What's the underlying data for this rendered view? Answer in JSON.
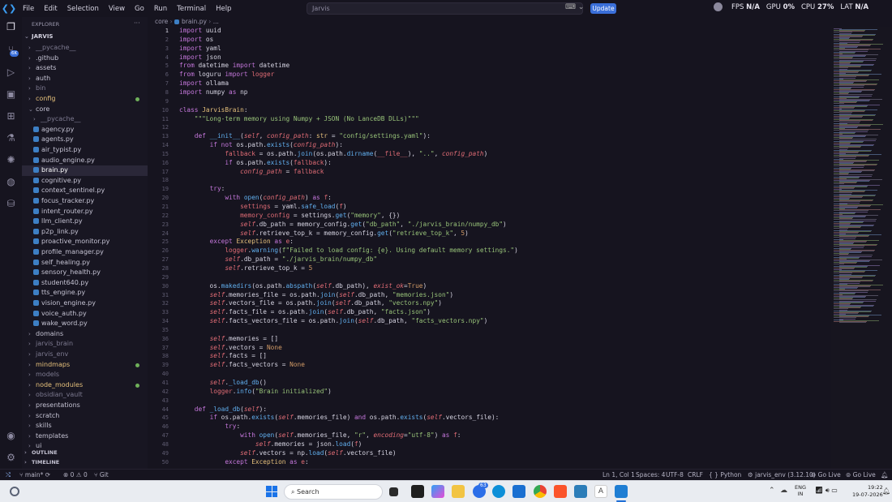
{
  "titlebar": {
    "menus": [
      "File",
      "Edit",
      "Selection",
      "View",
      "Go",
      "Run",
      "Terminal",
      "Help"
    ],
    "search_placeholder": "Jarvis",
    "update_label": "Update"
  },
  "perf": {
    "fps_label": "FPS",
    "fps_value": "N/A",
    "gpu_label": "GPU",
    "gpu_value": "0%",
    "cpu_label": "CPU",
    "cpu_value": "27%",
    "lat_label": "LAT",
    "lat_value": "N/A"
  },
  "sidebar": {
    "title": "EXPLORER",
    "root": "JARVIS",
    "items": [
      {
        "label": "__pycache__",
        "depth": 1,
        "folder": true,
        "dim": true
      },
      {
        "label": ".github",
        "depth": 1,
        "folder": true
      },
      {
        "label": "assets",
        "depth": 1,
        "folder": true
      },
      {
        "label": "auth",
        "depth": 1,
        "folder": true
      },
      {
        "label": "bin",
        "depth": 1,
        "folder": true,
        "dim": true
      },
      {
        "label": "config",
        "depth": 1,
        "folder": true,
        "mod": true,
        "color": "#e5c07b"
      },
      {
        "label": "core",
        "depth": 1,
        "folder": true,
        "open": true
      },
      {
        "label": "__pycache__",
        "depth": 2,
        "folder": true,
        "dim": true
      },
      {
        "label": "agency.py",
        "depth": 2
      },
      {
        "label": "agents.py",
        "depth": 2
      },
      {
        "label": "air_typist.py",
        "depth": 2
      },
      {
        "label": "audio_engine.py",
        "depth": 2
      },
      {
        "label": "brain.py",
        "depth": 2,
        "selected": true
      },
      {
        "label": "cognitive.py",
        "depth": 2
      },
      {
        "label": "context_sentinel.py",
        "depth": 2
      },
      {
        "label": "focus_tracker.py",
        "depth": 2
      },
      {
        "label": "intent_router.py",
        "depth": 2
      },
      {
        "label": "llm_client.py",
        "depth": 2
      },
      {
        "label": "p2p_link.py",
        "depth": 2
      },
      {
        "label": "proactive_monitor.py",
        "depth": 2
      },
      {
        "label": "profile_manager.py",
        "depth": 2
      },
      {
        "label": "self_healing.py",
        "depth": 2
      },
      {
        "label": "sensory_health.py",
        "depth": 2
      },
      {
        "label": "student640.py",
        "depth": 2
      },
      {
        "label": "tts_engine.py",
        "depth": 2
      },
      {
        "label": "vision_engine.py",
        "depth": 2
      },
      {
        "label": "voice_auth.py",
        "depth": 2
      },
      {
        "label": "wake_word.py",
        "depth": 2
      },
      {
        "label": "domains",
        "depth": 1,
        "folder": true
      },
      {
        "label": "jarvis_brain",
        "depth": 1,
        "folder": true,
        "dim": true
      },
      {
        "label": "jarvis_env",
        "depth": 1,
        "folder": true,
        "dim": true
      },
      {
        "label": "mindmaps",
        "depth": 1,
        "folder": true,
        "mod": true,
        "color": "#e5c07b"
      },
      {
        "label": "models",
        "depth": 1,
        "folder": true,
        "dim": true
      },
      {
        "label": "node_modules",
        "depth": 1,
        "folder": true,
        "mod": true,
        "color": "#e5c07b"
      },
      {
        "label": "obsidian_vault",
        "depth": 1,
        "folder": true,
        "dim": true
      },
      {
        "label": "presentations",
        "depth": 1,
        "folder": true
      },
      {
        "label": "scratch",
        "depth": 1,
        "folder": true
      },
      {
        "label": "skills",
        "depth": 1,
        "folder": true
      },
      {
        "label": "templates",
        "depth": 1,
        "folder": true
      },
      {
        "label": "ui",
        "depth": 1,
        "folder": true
      }
    ],
    "outline": "OUTLINE",
    "timeline": "TIMELINE"
  },
  "breadcrumb": {
    "folder": "core",
    "file": "brain.py",
    "tail": "..."
  },
  "code": [
    "<k>import</k> uuid",
    "<k>import</k> os",
    "<k>import</k> yaml",
    "<k>import</k> json",
    "<k>from</k> datetime <k>import</k> datetime",
    "<k>from</k> loguru <k>import</k> <v>logger</v>",
    "<k>import</k> ollama",
    "<k>import</k> numpy <k>as</k> np",
    "",
    "<k>class</k> <p>JarvisBrain</p>:",
    "    <s>\"\"\"Long-term memory using Numpy + JSON (No LanceDB DLLs)\"\"\"</s>",
    "",
    "    <k>def</k> <fn>__init__</fn>(<sf>self</sf>, <sf>config_path</sf>: <p>str</p> = <s>\"config/settings.yaml\"</s>):",
    "        <k>if not</k> os.path.<fn>exists</fn>(<sf>config_path</sf>):",
    "            <v>fallback</v> = os.path.<fn>join</fn>(os.path.<fn>dirname</fn>(<v>__file__</v>), <s>\"..\"</s>, <sf>config_path</sf>)",
    "            <k>if</k> os.path.<fn>exists</fn>(<v>fallback</v>):",
    "                <sf>config_path</sf> = <v>fallback</v>",
    "",
    "        <k>try</k>:",
    "            <k>with</k> <fn>open</fn>(<sf>config_path</sf>) <k>as</k> <v>f</v>:",
    "                <v>settings</v> = yaml.<fn>safe_load</fn>(<v>f</v>)",
    "                <v>memory_config</v> = settings.<fn>get</fn>(<s>\"memory\"</s>, {})",
    "                <sf>self</sf>.db_path = memory_config.<fn>get</fn>(<s>\"db_path\"</s>, <s>\"./jarvis_brain/numpy_db\"</s>)",
    "                <sf>self</sf>.retrieve_top_k = memory_config.<fn>get</fn>(<s>\"retrieve_top_k\"</s>, <n>5</n>)",
    "        <k>except</k> <p>Exception</p> <k>as</k> <v>e</v>:",
    "            <v>logger</v>.<fn>warning</fn>(<s>f\"Failed to load config: {e}. Using default memory settings.\"</s>)",
    "            <sf>self</sf>.db_path = <s>\"./jarvis_brain/numpy_db\"</s>",
    "            <sf>self</sf>.retrieve_top_k = <n>5</n>",
    "",
    "        os.<fn>makedirs</fn>(os.path.<fn>abspath</fn>(<sf>self</sf>.db_path), <sf>exist_ok</sf>=<n>True</n>)",
    "        <sf>self</sf>.memories_file = os.path.<fn>join</fn>(<sf>self</sf>.db_path, <s>\"memories.json\"</s>)",
    "        <sf>self</sf>.vectors_file = os.path.<fn>join</fn>(<sf>self</sf>.db_path, <s>\"vectors.npy\"</s>)",
    "        <sf>self</sf>.facts_file = os.path.<fn>join</fn>(<sf>self</sf>.db_path, <s>\"facts.json\"</s>)",
    "        <sf>self</sf>.facts_vectors_file = os.path.<fn>join</fn>(<sf>self</sf>.db_path, <s>\"facts_vectors.npy\"</s>)",
    "",
    "        <sf>self</sf>.memories = []",
    "        <sf>self</sf>.vectors = <n>None</n>",
    "        <sf>self</sf>.facts = []",
    "        <sf>self</sf>.facts_vectors = <n>None</n>",
    "",
    "        <sf>self</sf>.<fn>_load_db</fn>()",
    "        <v>logger</v>.<fn>info</fn>(<s>\"Brain initialized\"</s>)",
    "",
    "    <k>def</k> <fn>_load_db</fn>(<sf>self</sf>):",
    "        <k>if</k> os.path.<fn>exists</fn>(<sf>self</sf>.memories_file) <k>and</k> os.path.<fn>exists</fn>(<sf>self</sf>.vectors_file):",
    "            <k>try</k>:",
    "                <k>with</k> <fn>open</fn>(<sf>self</sf>.memories_file, <s>\"r\"</s>, <sf>encoding</sf>=<s>\"utf-8\"</s>) <k>as</k> <v>f</v>:",
    "                    <sf>self</sf>.memories = json.<fn>load</fn>(<v>f</v>)",
    "                <sf>self</sf>.vectors = np.<fn>load</fn>(<sf>self</sf>.vectors_file)",
    "            <k>except</k> <p>Exception</p> <k>as</k> <v>e</v>:"
  ],
  "statusbar": {
    "branch": "main*",
    "errors": "0",
    "warnings": "0",
    "git": "Git",
    "position": "Ln 1, Col 1",
    "spaces": "Spaces: 4",
    "encoding": "UTF-8",
    "eol": "CRLF",
    "language": "Python",
    "interpreter": "jarvis_env (3.12.10)",
    "golive1": "Go Live",
    "golive2": "Go Live"
  },
  "taskbar": {
    "search_placeholder": "Search",
    "lang": "ENG",
    "region": "IN",
    "time": "19:22",
    "date": "19-07-2026",
    "badge": "63"
  },
  "activity_badge": "6K"
}
